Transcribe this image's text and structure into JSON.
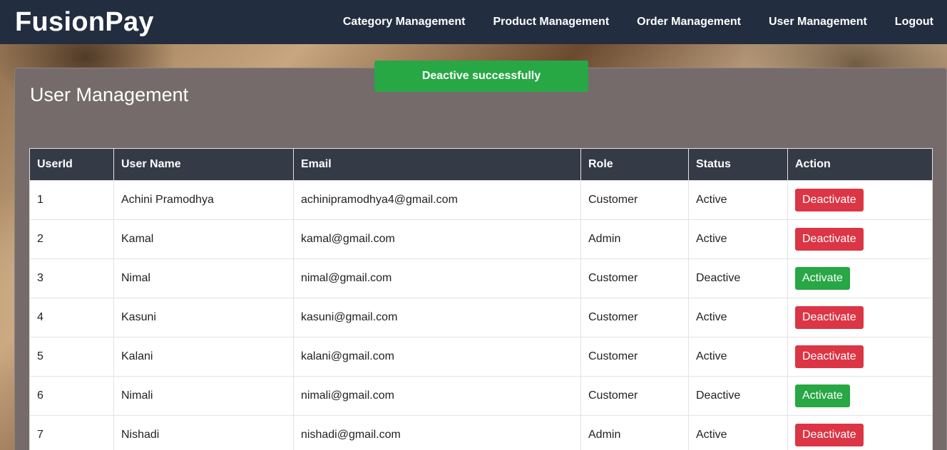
{
  "navbar": {
    "brand": "FusionPay",
    "links": [
      "Category Management",
      "Product Management",
      "Order Management",
      "User Management",
      "Logout"
    ]
  },
  "toast": {
    "message": "Deactive successfully",
    "color": "#28a745"
  },
  "page": {
    "title": "User Management"
  },
  "table": {
    "headers": [
      "UserId",
      "User Name",
      "Email",
      "Role",
      "Status",
      "Action"
    ],
    "rows": [
      {
        "id": "1",
        "name": "Achini Pramodhya",
        "email": "achinipramodhya4@gmail.com",
        "role": "Customer",
        "status": "Active",
        "action": "Deactivate"
      },
      {
        "id": "2",
        "name": "Kamal",
        "email": "kamal@gmail.com",
        "role": "Admin",
        "status": "Active",
        "action": "Deactivate"
      },
      {
        "id": "3",
        "name": "Nimal",
        "email": "nimal@gmail.com",
        "role": "Customer",
        "status": "Deactive",
        "action": "Activate"
      },
      {
        "id": "4",
        "name": "Kasuni",
        "email": "kasuni@gmail.com",
        "role": "Customer",
        "status": "Active",
        "action": "Deactivate"
      },
      {
        "id": "5",
        "name": "Kalani",
        "email": "kalani@gmail.com",
        "role": "Customer",
        "status": "Active",
        "action": "Deactivate"
      },
      {
        "id": "6",
        "name": "Nimali",
        "email": "nimali@gmail.com",
        "role": "Customer",
        "status": "Deactive",
        "action": "Activate"
      },
      {
        "id": "7",
        "name": "Nishadi",
        "email": "nishadi@gmail.com",
        "role": "Admin",
        "status": "Active",
        "action": "Deactivate"
      }
    ]
  },
  "colors": {
    "navbar": "#222d3f",
    "table_header": "#343a46",
    "deactivate_button": "#dc3545",
    "activate_button": "#28a745",
    "panel": "#766b6b"
  }
}
